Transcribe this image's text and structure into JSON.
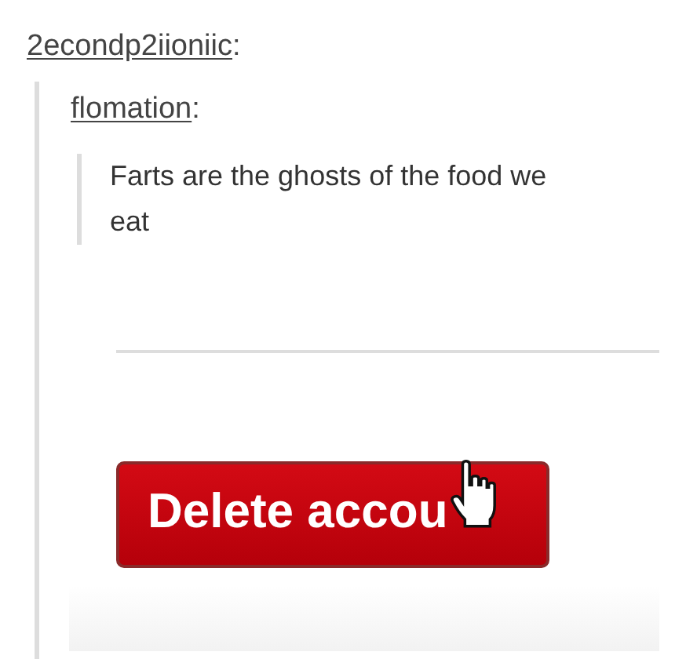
{
  "post": {
    "author": "2econdp2iioniic",
    "colon": ":",
    "reblog": {
      "author": "flomation",
      "colon": ":",
      "quote": "Farts are the ghosts of the food we eat",
      "embedded_screenshot": {
        "button": {
          "label": "Delete accou"
        },
        "hand_cursor": true
      }
    }
  }
}
